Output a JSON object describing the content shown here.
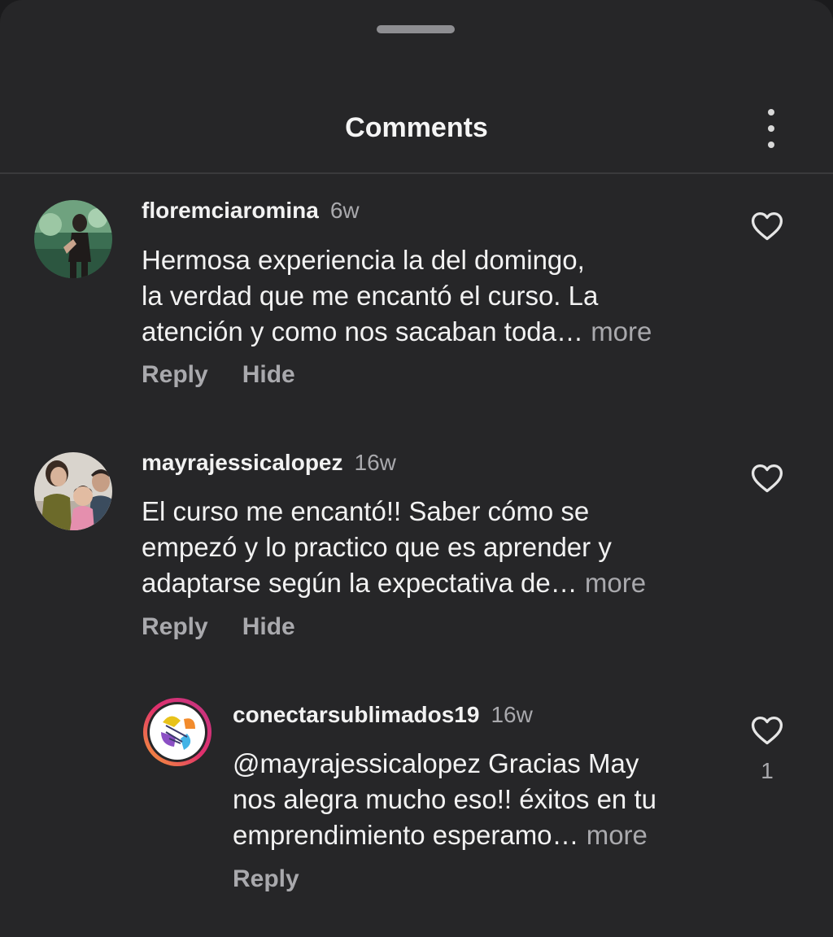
{
  "header": {
    "title": "Comments",
    "menu_icon": "more-vertical-icon"
  },
  "comments": [
    {
      "author": "floremciaromina",
      "time": "6w",
      "lines": [
        "Hermosa experiencia la del domingo,",
        "la verdad que me encantó el curso. La",
        "atención y como nos sacaban toda…"
      ],
      "more": "more",
      "reply": "Reply",
      "hide": "Hide"
    },
    {
      "author": "mayrajessicalopez",
      "time": "16w",
      "lines": [
        "El curso me encantó!! Saber cómo se",
        "empezó y lo practico que es aprender y",
        "adaptarse según la expectativa de…"
      ],
      "more": "more",
      "reply": "Reply",
      "hide": "Hide"
    },
    {
      "author": "conectarsublimados19",
      "time": "16w",
      "lines": [
        "@mayrajessicalopez Gracias May",
        "nos alegra mucho eso!! éxitos en tu",
        "emprendimiento esperamo…"
      ],
      "more": "more",
      "reply": "Reply",
      "likes": "1"
    }
  ],
  "colors": {
    "background": "#262628",
    "text": "#f2f2f2",
    "muted": "#a9a9ad"
  }
}
